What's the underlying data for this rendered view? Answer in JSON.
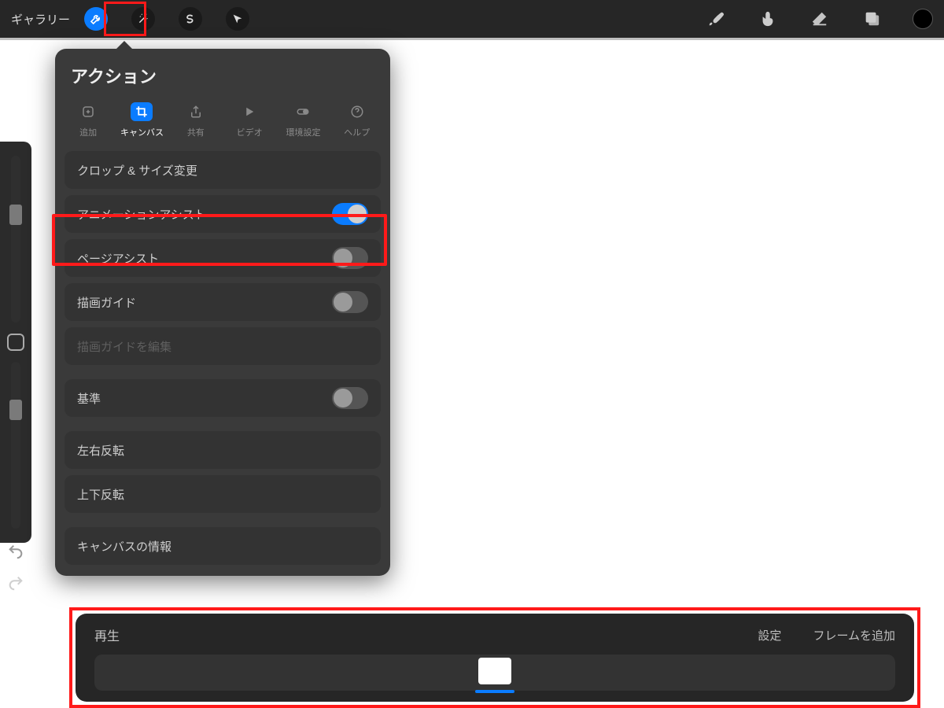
{
  "topbar": {
    "gallery": "ギャラリー"
  },
  "popover": {
    "title": "アクション",
    "tabs": {
      "add": "追加",
      "canvas": "キャンバス",
      "share": "共有",
      "video": "ビデオ",
      "prefs": "環境設定",
      "help": "ヘルプ"
    },
    "rows": {
      "crop": "クロップ & サイズ変更",
      "anim_assist": "アニメーションアシスト",
      "page_assist": "ページアシスト",
      "guide": "描画ガイド",
      "guide_edit": "描画ガイドを編集",
      "reference": "基準",
      "flip_h": "左右反転",
      "flip_v": "上下反転",
      "canvas_info": "キャンバスの情報"
    },
    "toggles": {
      "anim_assist": true,
      "page_assist": false,
      "guide": false,
      "reference": false
    }
  },
  "timeline": {
    "play": "再生",
    "settings": "設定",
    "add_frame": "フレームを追加"
  }
}
